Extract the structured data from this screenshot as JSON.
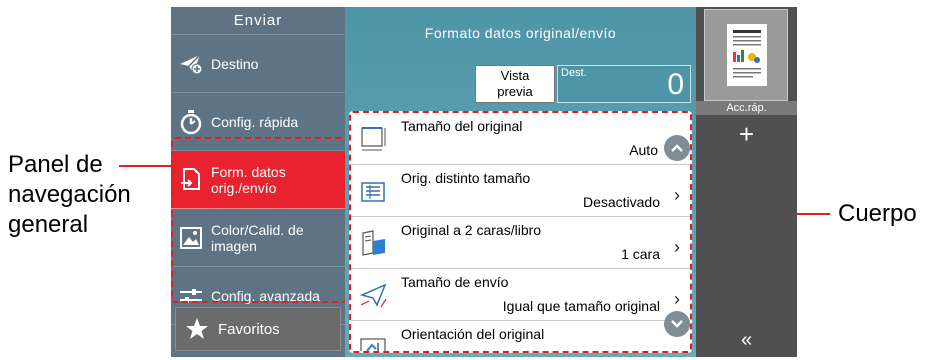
{
  "annotations": {
    "left_label": "Panel de navegación general",
    "right_label": "Cuerpo"
  },
  "sidebar": {
    "title": "Enviar",
    "items": [
      {
        "label": "Destino",
        "icon": "paper-plane-add-icon"
      },
      {
        "label": "Config. rápida",
        "icon": "stopwatch-icon"
      },
      {
        "label": "Form. datos orig./envío",
        "icon": "document-format-icon",
        "active": true
      },
      {
        "label": "Color/Calid. de imagen",
        "icon": "image-quality-icon"
      },
      {
        "label": "Config. avanzada",
        "icon": "sliders-icon"
      }
    ],
    "favorites": {
      "label": "Favoritos",
      "icon": "star-icon"
    }
  },
  "main": {
    "title": "Formato datos original/envío",
    "preview_button": {
      "line1": "Vista",
      "line2": "previa"
    },
    "destination": {
      "label": "Dest.",
      "count": "0"
    },
    "rows": [
      {
        "label": "Tamaño del original",
        "value": "Auto",
        "icon": "original-size-icon"
      },
      {
        "label": "Orig. distinto tamaño",
        "value": "Desactivado",
        "icon": "mixed-size-icon"
      },
      {
        "label": "Original a 2 caras/libro",
        "value": "1 cara",
        "icon": "duplex-book-icon"
      },
      {
        "label": "Tamaño de envío",
        "value": "Igual que tamaño original",
        "icon": "send-size-icon"
      },
      {
        "label": "Orientación del original",
        "value": "",
        "icon": "orientation-icon"
      }
    ]
  },
  "right_panel": {
    "shortcut_label": "Acc.ráp.",
    "add_symbol": "+",
    "collapse_symbol": "«"
  },
  "colors": {
    "sidebar_bg": "#5e7484",
    "active_item": "#e8232f",
    "main_bg": "#5a9fb0",
    "annotation_frame": "#e02020"
  }
}
